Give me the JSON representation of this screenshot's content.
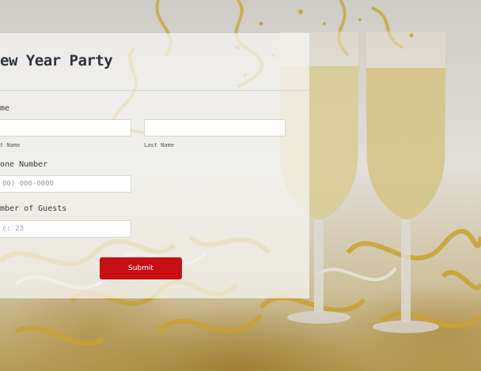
{
  "form": {
    "title": "ew Year Party",
    "name_label": "me",
    "first_name_sublabel": "t Name",
    "last_name_sublabel": "Last Name",
    "phone_label": "one Number",
    "phone_placeholder": "00) 000-0000",
    "guests_label": "mber of Guests",
    "guests_placeholder": "c: 23",
    "submit_label": "Submit"
  },
  "colors": {
    "submit_button": "#c80f14",
    "title_text": "#2f3340"
  },
  "icons": {}
}
